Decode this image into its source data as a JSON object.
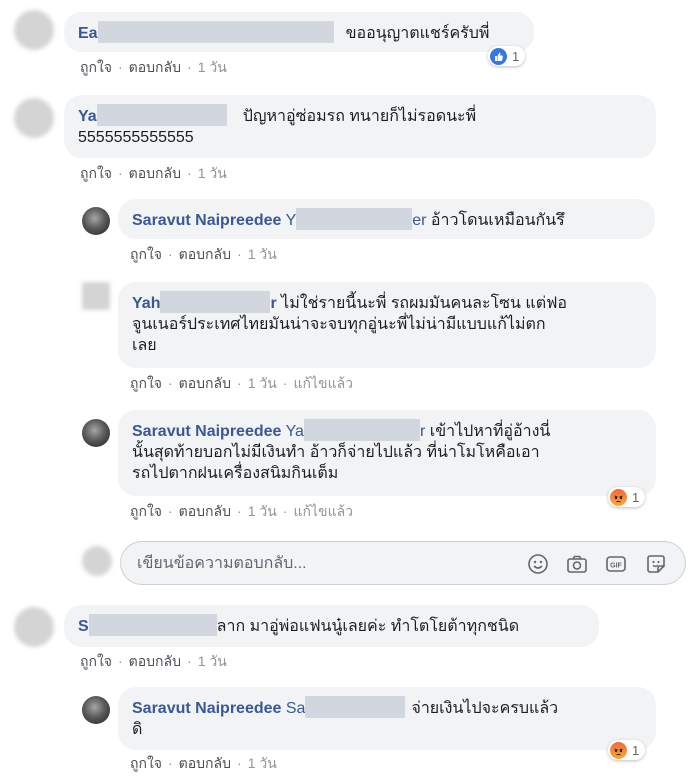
{
  "actions": {
    "like": "ถูกใจ",
    "reply": "ตอบกลับ",
    "edited": "แก้ไขแล้ว",
    "separator": "·"
  },
  "comments": [
    {
      "author": "Ea",
      "text": "ขออนุญาตแชร์ครับพี่",
      "time": "1 วัน",
      "reaction": {
        "type": "like-icon",
        "count": "1"
      }
    },
    {
      "author": "Ya",
      "line1": "ปัญหาอู่ซ่อมรถ ทนายก็ไม่รอดนะพี่",
      "line2": "5555555555555",
      "time": "1 วัน"
    },
    {
      "author": "Saravut Naipreedee",
      "tag": "Y",
      "tag_tail": "er",
      "text": "อ้าวโดนเหมือนกันรึ",
      "time": "1 วัน"
    },
    {
      "author": "Yah",
      "author_tail": "r",
      "line1": "ไม่ใช่รายนี้นะพี่ รถผมมันคนละโซน แต่ฟอ",
      "line2": "จูนเนอร์ประเทศไทยมันน่าจะจบทุกอู่นะพี่ไม่น่ามีแบบแก้ไม่ตก",
      "line3": "เลย",
      "time": "1 วัน"
    },
    {
      "author": "Saravut Naipreedee",
      "tag": "Ya",
      "tag_tail": "r",
      "line1": "เข้าไปหาที่อู่อ้างนี่",
      "line2": "นั้นสุดท้ายบอกไม่มีเงินทำ อ้าวก็จ่ายไปแล้ว ที่น่าโมโหคือเอา",
      "line3": "รถไปตากฝนเครื่องสนิมกินเต็ม",
      "time": "1 วัน",
      "reaction": {
        "type": "angry-icon",
        "count": "1"
      }
    },
    {
      "author": "S",
      "text": "ลาก มาอู่พ่อแฟนนู๋เลยค่ะ ทำโตโยต้าทุกชนิด",
      "time": "1 วัน"
    },
    {
      "author": "Saravut Naipreedee",
      "tag": "Sa",
      "line1": "จ่ายเงินไปจะครบแล้ว",
      "line2": "ดิ",
      "time": "1 วัน",
      "reaction": {
        "type": "angry-icon",
        "count": "1"
      }
    }
  ],
  "reply_box": {
    "placeholder": "เขียนข้อความตอบกลับ...",
    "icons": [
      "emoji-icon",
      "camera-icon",
      "gif-icon",
      "sticker-icon"
    ]
  }
}
